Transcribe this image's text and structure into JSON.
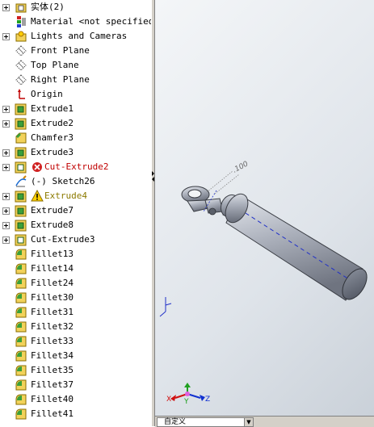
{
  "tree": {
    "items": [
      {
        "label": "实体(2)",
        "icon": "solid-bodies-folder-icon",
        "expander": true,
        "style": "normal"
      },
      {
        "label": "Material <not specified>",
        "icon": "material-icon",
        "expander": false,
        "style": "normal"
      },
      {
        "label": "Lights and Cameras",
        "icon": "lights-folder-icon",
        "expander": true,
        "style": "normal"
      },
      {
        "label": "Front Plane",
        "icon": "plane-icon",
        "expander": false,
        "style": "normal"
      },
      {
        "label": "Top Plane",
        "icon": "plane-icon",
        "expander": false,
        "style": "normal"
      },
      {
        "label": "Right Plane",
        "icon": "plane-icon",
        "expander": false,
        "style": "normal"
      },
      {
        "label": "Origin",
        "icon": "origin-icon",
        "expander": false,
        "style": "normal"
      },
      {
        "label": "Extrude1",
        "icon": "extrude-icon",
        "expander": true,
        "style": "normal"
      },
      {
        "label": "Extrude2",
        "icon": "extrude-icon",
        "expander": true,
        "style": "normal"
      },
      {
        "label": "Chamfer3",
        "icon": "chamfer-icon",
        "expander": false,
        "style": "normal"
      },
      {
        "label": "Extrude3",
        "icon": "extrude-icon",
        "expander": true,
        "style": "normal"
      },
      {
        "label": "Cut-Extrude2",
        "icon": "cut-extrude-icon",
        "status_icon": "error-icon",
        "expander": true,
        "style": "error"
      },
      {
        "label": "(-) Sketch26",
        "icon": "sketch-icon",
        "expander": false,
        "style": "normal"
      },
      {
        "label": "Extrude4",
        "icon": "extrude-icon",
        "status_icon": "warning-icon",
        "expander": true,
        "style": "warn"
      },
      {
        "label": "Extrude7",
        "icon": "extrude-icon",
        "expander": true,
        "style": "normal"
      },
      {
        "label": "Extrude8",
        "icon": "extrude-icon",
        "expander": true,
        "style": "normal"
      },
      {
        "label": "Cut-Extrude3",
        "icon": "cut-extrude-icon",
        "expander": true,
        "style": "normal"
      },
      {
        "label": "Fillet13",
        "icon": "fillet-icon",
        "expander": false,
        "style": "normal"
      },
      {
        "label": "Fillet14",
        "icon": "fillet-icon",
        "expander": false,
        "style": "normal"
      },
      {
        "label": "Fillet24",
        "icon": "fillet-icon",
        "expander": false,
        "style": "normal"
      },
      {
        "label": "Fillet30",
        "icon": "fillet-icon",
        "expander": false,
        "style": "normal"
      },
      {
        "label": "Fillet31",
        "icon": "fillet-icon",
        "expander": false,
        "style": "normal"
      },
      {
        "label": "Fillet32",
        "icon": "fillet-icon",
        "expander": false,
        "style": "normal"
      },
      {
        "label": "Fillet33",
        "icon": "fillet-icon",
        "expander": false,
        "style": "normal"
      },
      {
        "label": "Fillet34",
        "icon": "fillet-icon",
        "expander": false,
        "style": "normal"
      },
      {
        "label": "Fillet35",
        "icon": "fillet-icon",
        "expander": false,
        "style": "normal"
      },
      {
        "label": "Fillet37",
        "icon": "fillet-icon",
        "expander": false,
        "style": "normal"
      },
      {
        "label": "Fillet40",
        "icon": "fillet-icon",
        "expander": false,
        "style": "normal"
      },
      {
        "label": "Fillet41",
        "icon": "fillet-icon",
        "expander": false,
        "style": "normal"
      }
    ]
  },
  "viewport": {
    "dimension_label": ".100",
    "triad_labels": {
      "x": "X",
      "y": "Y",
      "z": "Z"
    }
  },
  "statusbar": {
    "view_selector_value": "自定义"
  },
  "colors": {
    "error_text": "#c00000",
    "warning_text": "#8c7a00",
    "model_body": "#b8bcc6"
  }
}
